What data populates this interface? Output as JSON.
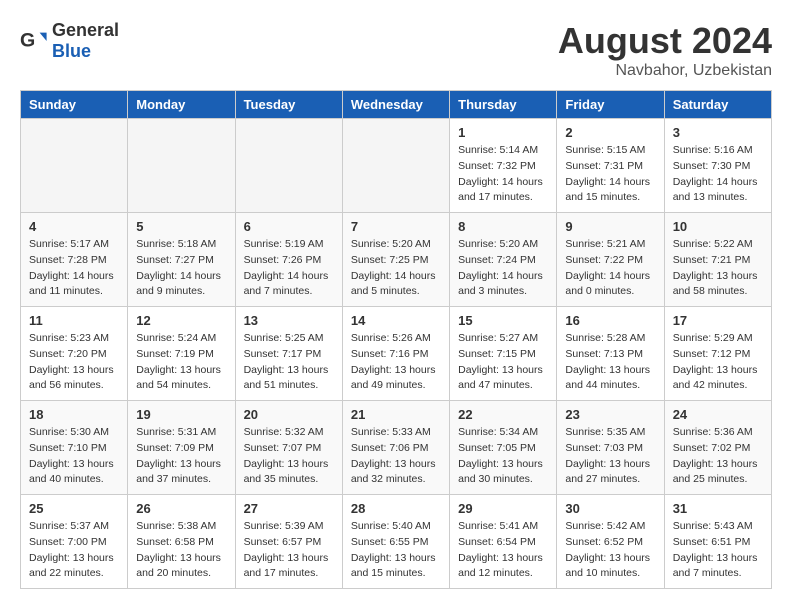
{
  "header": {
    "logo_general": "General",
    "logo_blue": "Blue",
    "month_year": "August 2024",
    "location": "Navbahor, Uzbekistan"
  },
  "days_of_week": [
    "Sunday",
    "Monday",
    "Tuesday",
    "Wednesday",
    "Thursday",
    "Friday",
    "Saturday"
  ],
  "weeks": [
    [
      {
        "day": "",
        "info": ""
      },
      {
        "day": "",
        "info": ""
      },
      {
        "day": "",
        "info": ""
      },
      {
        "day": "",
        "info": ""
      },
      {
        "day": "1",
        "info": "Sunrise: 5:14 AM\nSunset: 7:32 PM\nDaylight: 14 hours\nand 17 minutes."
      },
      {
        "day": "2",
        "info": "Sunrise: 5:15 AM\nSunset: 7:31 PM\nDaylight: 14 hours\nand 15 minutes."
      },
      {
        "day": "3",
        "info": "Sunrise: 5:16 AM\nSunset: 7:30 PM\nDaylight: 14 hours\nand 13 minutes."
      }
    ],
    [
      {
        "day": "4",
        "info": "Sunrise: 5:17 AM\nSunset: 7:28 PM\nDaylight: 14 hours\nand 11 minutes."
      },
      {
        "day": "5",
        "info": "Sunrise: 5:18 AM\nSunset: 7:27 PM\nDaylight: 14 hours\nand 9 minutes."
      },
      {
        "day": "6",
        "info": "Sunrise: 5:19 AM\nSunset: 7:26 PM\nDaylight: 14 hours\nand 7 minutes."
      },
      {
        "day": "7",
        "info": "Sunrise: 5:20 AM\nSunset: 7:25 PM\nDaylight: 14 hours\nand 5 minutes."
      },
      {
        "day": "8",
        "info": "Sunrise: 5:20 AM\nSunset: 7:24 PM\nDaylight: 14 hours\nand 3 minutes."
      },
      {
        "day": "9",
        "info": "Sunrise: 5:21 AM\nSunset: 7:22 PM\nDaylight: 14 hours\nand 0 minutes."
      },
      {
        "day": "10",
        "info": "Sunrise: 5:22 AM\nSunset: 7:21 PM\nDaylight: 13 hours\nand 58 minutes."
      }
    ],
    [
      {
        "day": "11",
        "info": "Sunrise: 5:23 AM\nSunset: 7:20 PM\nDaylight: 13 hours\nand 56 minutes."
      },
      {
        "day": "12",
        "info": "Sunrise: 5:24 AM\nSunset: 7:19 PM\nDaylight: 13 hours\nand 54 minutes."
      },
      {
        "day": "13",
        "info": "Sunrise: 5:25 AM\nSunset: 7:17 PM\nDaylight: 13 hours\nand 51 minutes."
      },
      {
        "day": "14",
        "info": "Sunrise: 5:26 AM\nSunset: 7:16 PM\nDaylight: 13 hours\nand 49 minutes."
      },
      {
        "day": "15",
        "info": "Sunrise: 5:27 AM\nSunset: 7:15 PM\nDaylight: 13 hours\nand 47 minutes."
      },
      {
        "day": "16",
        "info": "Sunrise: 5:28 AM\nSunset: 7:13 PM\nDaylight: 13 hours\nand 44 minutes."
      },
      {
        "day": "17",
        "info": "Sunrise: 5:29 AM\nSunset: 7:12 PM\nDaylight: 13 hours\nand 42 minutes."
      }
    ],
    [
      {
        "day": "18",
        "info": "Sunrise: 5:30 AM\nSunset: 7:10 PM\nDaylight: 13 hours\nand 40 minutes."
      },
      {
        "day": "19",
        "info": "Sunrise: 5:31 AM\nSunset: 7:09 PM\nDaylight: 13 hours\nand 37 minutes."
      },
      {
        "day": "20",
        "info": "Sunrise: 5:32 AM\nSunset: 7:07 PM\nDaylight: 13 hours\nand 35 minutes."
      },
      {
        "day": "21",
        "info": "Sunrise: 5:33 AM\nSunset: 7:06 PM\nDaylight: 13 hours\nand 32 minutes."
      },
      {
        "day": "22",
        "info": "Sunrise: 5:34 AM\nSunset: 7:05 PM\nDaylight: 13 hours\nand 30 minutes."
      },
      {
        "day": "23",
        "info": "Sunrise: 5:35 AM\nSunset: 7:03 PM\nDaylight: 13 hours\nand 27 minutes."
      },
      {
        "day": "24",
        "info": "Sunrise: 5:36 AM\nSunset: 7:02 PM\nDaylight: 13 hours\nand 25 minutes."
      }
    ],
    [
      {
        "day": "25",
        "info": "Sunrise: 5:37 AM\nSunset: 7:00 PM\nDaylight: 13 hours\nand 22 minutes."
      },
      {
        "day": "26",
        "info": "Sunrise: 5:38 AM\nSunset: 6:58 PM\nDaylight: 13 hours\nand 20 minutes."
      },
      {
        "day": "27",
        "info": "Sunrise: 5:39 AM\nSunset: 6:57 PM\nDaylight: 13 hours\nand 17 minutes."
      },
      {
        "day": "28",
        "info": "Sunrise: 5:40 AM\nSunset: 6:55 PM\nDaylight: 13 hours\nand 15 minutes."
      },
      {
        "day": "29",
        "info": "Sunrise: 5:41 AM\nSunset: 6:54 PM\nDaylight: 13 hours\nand 12 minutes."
      },
      {
        "day": "30",
        "info": "Sunrise: 5:42 AM\nSunset: 6:52 PM\nDaylight: 13 hours\nand 10 minutes."
      },
      {
        "day": "31",
        "info": "Sunrise: 5:43 AM\nSunset: 6:51 PM\nDaylight: 13 hours\nand 7 minutes."
      }
    ]
  ]
}
